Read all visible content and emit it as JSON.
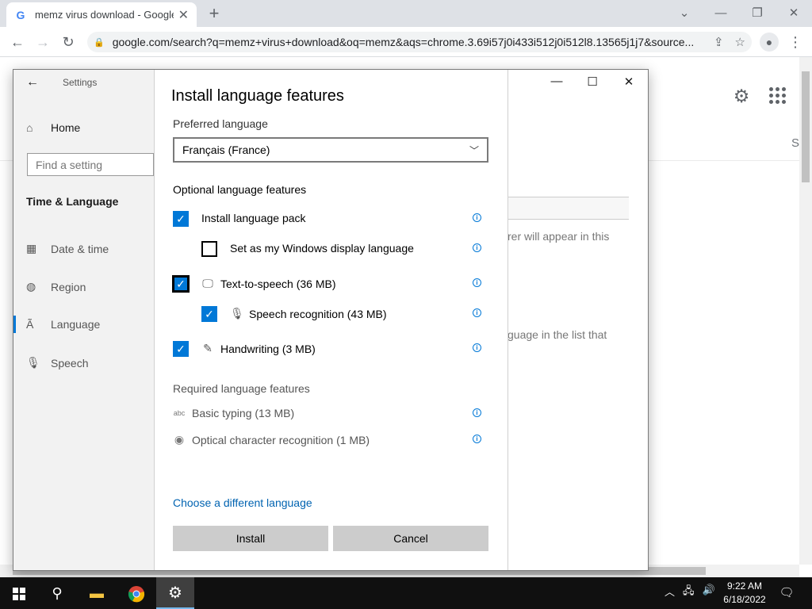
{
  "browser": {
    "tab_title": "memz virus download - Google S",
    "url": "google.com/search?q=memz+virus+download&oq=memz&aqs=chrome.3.69i57j0i433i512j0i512l8.13565j1j7&source..."
  },
  "google": {
    "right_letter": "S"
  },
  "settings": {
    "title": "Settings",
    "home": "Home",
    "find_placeholder": "Find a setting",
    "section": "Time & Language",
    "nav": [
      {
        "label": "Date & time",
        "icon": "calendar-icon"
      },
      {
        "label": "Region",
        "icon": "globe-icon"
      },
      {
        "label": "Language",
        "icon": "language-icon"
      },
      {
        "label": "Speech",
        "icon": "microphone-icon"
      }
    ],
    "right_text_1": "rer will appear in this",
    "right_text_2": "guage in the list that"
  },
  "dialog": {
    "title": "Install language features",
    "preferred_label": "Preferred language",
    "preferred_value": "Français (France)",
    "optional_label": "Optional language features",
    "optional": [
      {
        "label": "Install language pack",
        "checked": true
      },
      {
        "label": "Set as my Windows display language",
        "checked": false
      },
      {
        "label": "Text-to-speech (36 MB)",
        "checked": true
      },
      {
        "label": "Speech recognition (43 MB)",
        "checked": true
      },
      {
        "label": "Handwriting (3 MB)",
        "checked": true
      }
    ],
    "required_label": "Required language features",
    "required": [
      {
        "label": "Basic typing (13 MB)"
      },
      {
        "label": "Optical character recognition (1 MB)"
      }
    ],
    "choose_link": "Choose a different language",
    "install": "Install",
    "cancel": "Cancel"
  },
  "taskbar": {
    "time": "9:22 AM",
    "date": "6/18/2022"
  }
}
